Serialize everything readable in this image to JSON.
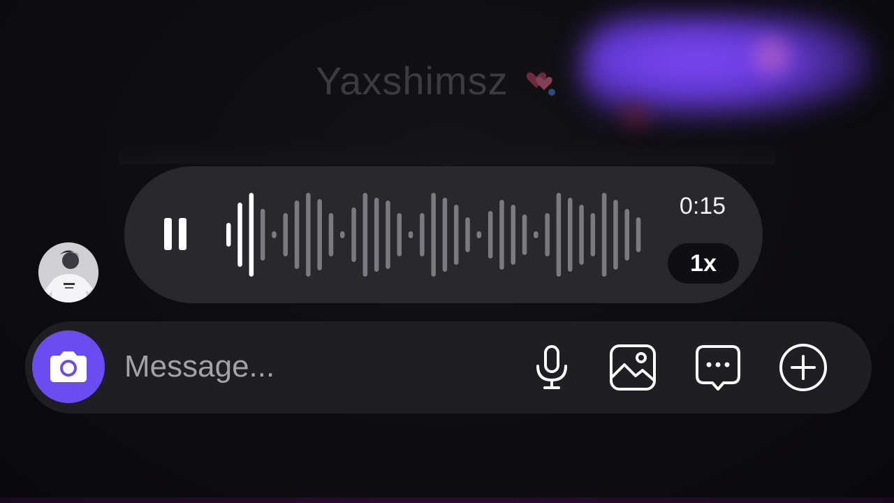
{
  "previous_message": {
    "text": "Yaxshimsz",
    "emoji": "heart-icon"
  },
  "voice_message": {
    "state_icon": "pause-icon",
    "duration": "0:15",
    "speed": "1x",
    "progress": 0.08
  },
  "composer": {
    "placeholder": "Message...",
    "camera_icon": "camera-icon",
    "tools": [
      "microphone-icon",
      "image-icon",
      "sticker-chat-icon",
      "plus-circle-icon"
    ]
  },
  "colors": {
    "accent": "#6a4cf0",
    "bubble": "#29282d",
    "composer": "#1f1e23",
    "wave_played": "#ffffff",
    "wave_unplayed": "#7a7a80"
  }
}
